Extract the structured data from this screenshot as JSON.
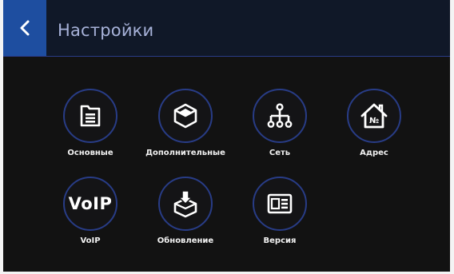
{
  "header": {
    "title": "Настройки",
    "back_icon": "chevron-left-icon",
    "accent_color": "#1e4ea0"
  },
  "menu": {
    "items": [
      {
        "label": "Основные",
        "icon": "document-icon"
      },
      {
        "label": "Дополнительные",
        "icon": "box-icon"
      },
      {
        "label": "Сеть",
        "icon": "network-icon"
      },
      {
        "label": "Адрес",
        "icon": "house-number-icon"
      },
      {
        "label": "VoIP",
        "icon": "voip-text-icon",
        "icon_text": "VoIP"
      },
      {
        "label": "Обновление",
        "icon": "update-box-icon"
      },
      {
        "label": "Версия",
        "icon": "id-card-icon"
      }
    ]
  }
}
